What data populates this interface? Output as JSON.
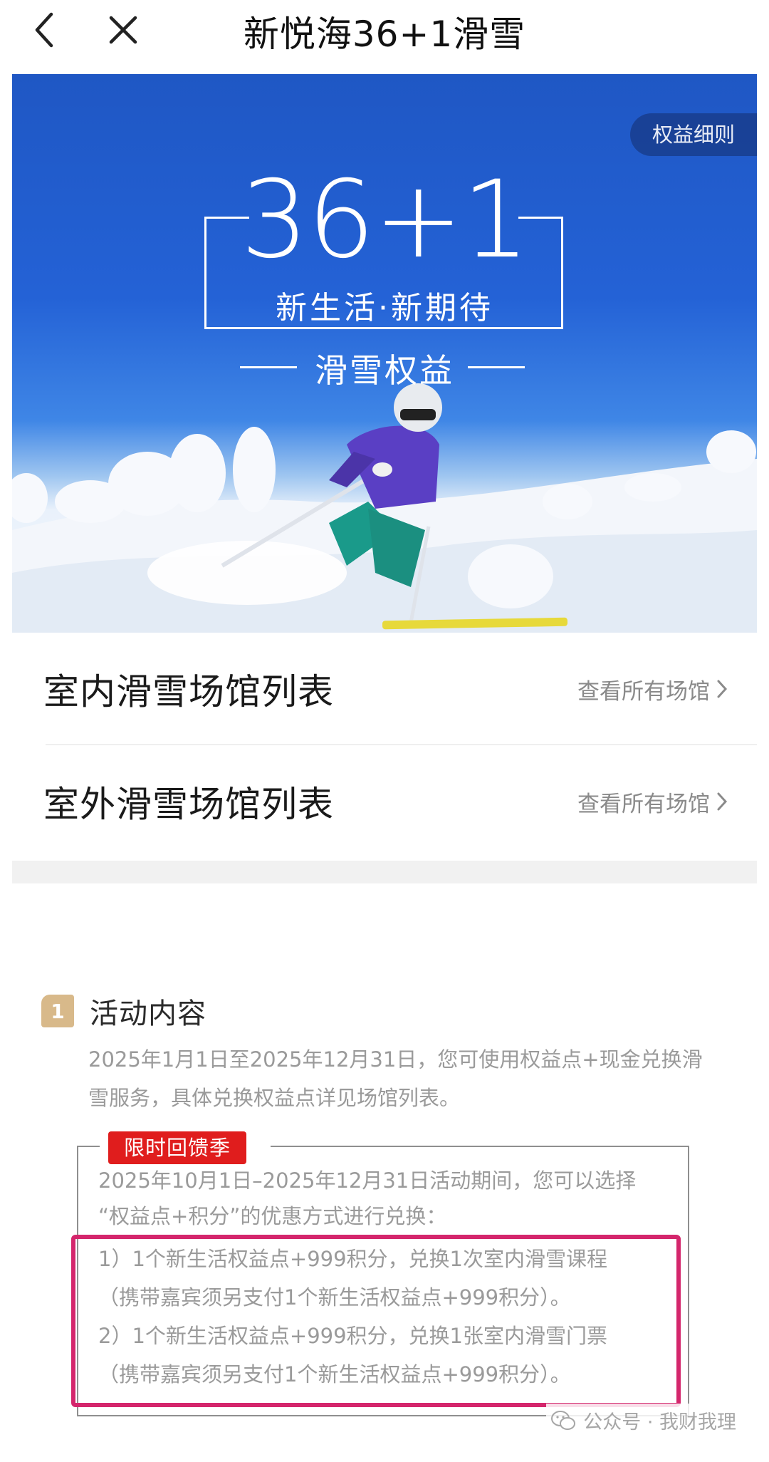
{
  "nav": {
    "title": "新悦海36+1滑雪",
    "back_icon": "chevron-left-icon",
    "close_icon": "close-icon"
  },
  "banner": {
    "rules_label": "权益细则",
    "logo_number": "36+1",
    "slogan": "新生活·新期待",
    "tagline": "滑雪权益",
    "colors": {
      "sky": "#2462d6",
      "snow": "#f4f6fa"
    }
  },
  "venues": [
    {
      "name": "室内滑雪场馆列表",
      "link": "查看所有场馆"
    },
    {
      "name": "室外滑雪场馆列表",
      "link": "查看所有场馆"
    }
  ],
  "activity": {
    "number": "1",
    "title": "活动内容",
    "description": "2025年1月1日至2025年12月31日，您可使用权益点+现金兑换滑雪服务，具体兑换权益点详见场馆列表。",
    "promo": {
      "tag": "限时回馈季",
      "intro_line1": "2025年10月1日–2025年12月31日活动期间，您可以选择",
      "intro_line2": "“权益点+积分”的优惠方式进行兑换：",
      "item1_line1": "1）1个新生活权益点+999积分，兑换1次室内滑雪课程",
      "item1_line2": "（携带嘉宾须另支付1个新生活权益点+999积分）。",
      "item2_line1": "2）1个新生活权益点+999积分，兑换1张室内滑雪门票",
      "item2_line2": "（携带嘉宾须另支付1个新生活权益点+999积分）。"
    }
  },
  "watermark": {
    "text": "公众号 · 我财我理",
    "icon": "wechat-icon"
  }
}
